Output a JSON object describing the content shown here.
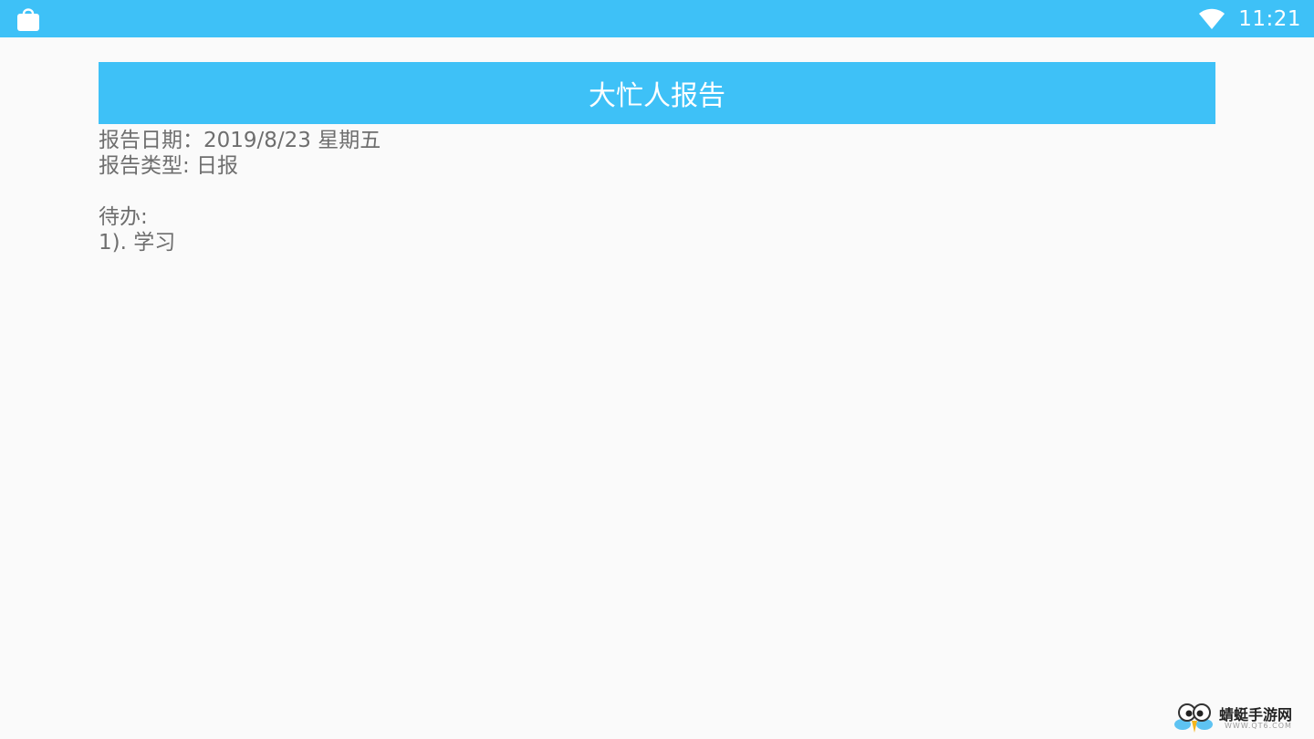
{
  "status_bar": {
    "time": "11:21",
    "left_icon": "shopping-bag-icon",
    "wifi_icon": "wifi-icon",
    "color": "#3ec1f7"
  },
  "header": {
    "title": "大忙人报告",
    "background": "#3ec1f7"
  },
  "report": {
    "date_line": "报告日期：2019/8/23 星期五",
    "type_line": "报告类型: 日报",
    "todo_heading": "待办:",
    "todo_items": [
      "1). 学习"
    ]
  },
  "watermark": {
    "name": "蜻蜓手游网",
    "url": "WWW.QT6.COM"
  }
}
